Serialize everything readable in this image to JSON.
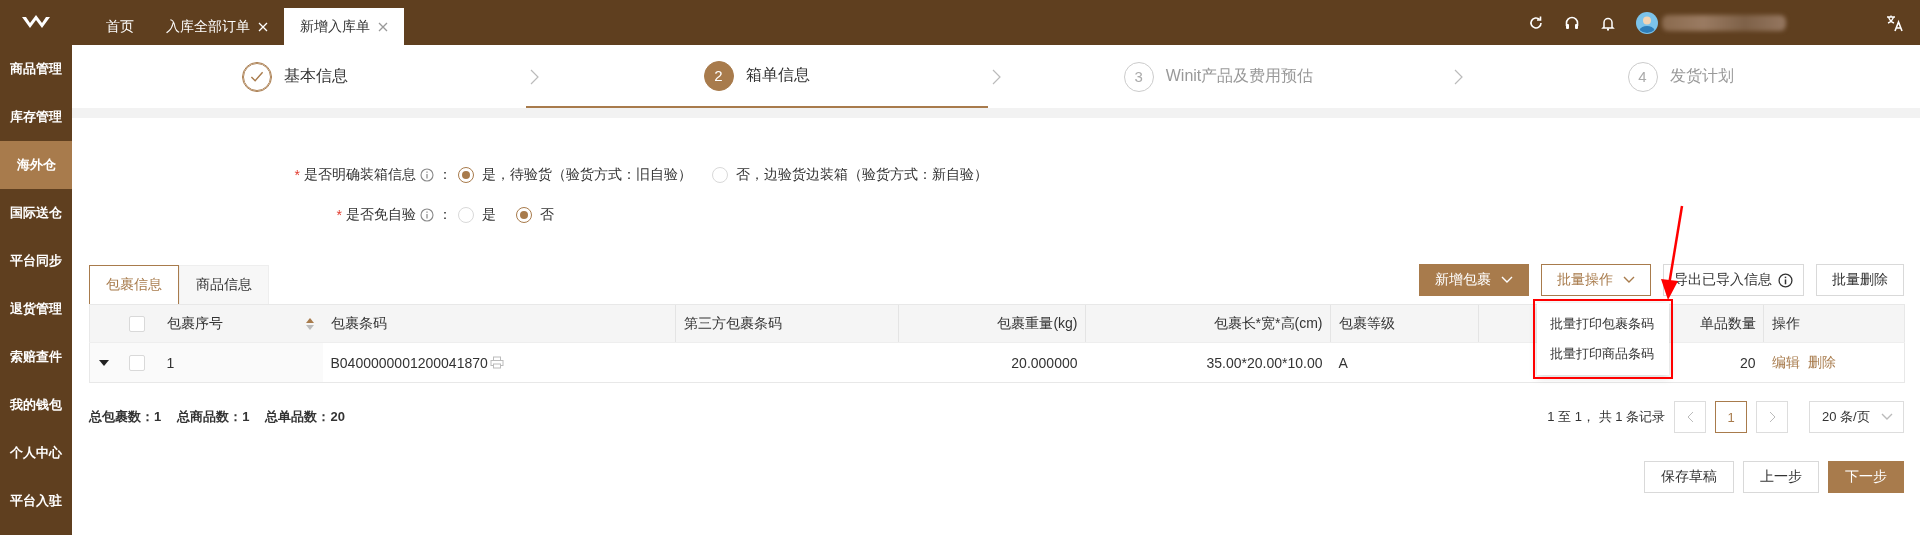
{
  "nav_tabs": [
    {
      "label": "首页",
      "closable": false,
      "selected": false
    },
    {
      "label": "入库全部订单",
      "closable": true,
      "selected": false
    },
    {
      "label": "新增入库单",
      "closable": true,
      "selected": true
    }
  ],
  "sidebar": {
    "items": [
      {
        "label": "商品管理",
        "selected": false
      },
      {
        "label": "库存管理",
        "selected": false
      },
      {
        "label": "海外仓",
        "selected": true
      },
      {
        "label": "国际送仓",
        "selected": false
      },
      {
        "label": "平台同步",
        "selected": false
      },
      {
        "label": "退货管理",
        "selected": false
      },
      {
        "label": "索赔查件",
        "selected": false
      },
      {
        "label": "我的钱包",
        "selected": false
      },
      {
        "label": "个人中心",
        "selected": false
      },
      {
        "label": "平台入驻",
        "selected": false
      }
    ]
  },
  "steps": [
    {
      "label": "基本信息",
      "done": true,
      "selected": false
    },
    {
      "number": "2",
      "label": "箱单信息",
      "done": false,
      "selected": true
    },
    {
      "number": "3",
      "label": "Winit产品及费用预估",
      "done": false,
      "selected": false
    },
    {
      "number": "4",
      "label": "发货计划",
      "done": false,
      "selected": false
    }
  ],
  "form": [
    {
      "required_mark": "*",
      "label": "是否明确装箱信息",
      "colon": "：",
      "options": [
        {
          "label": "是，待验货（验货方式：旧自验）",
          "selected": true
        },
        {
          "label": "否，边验货边装箱（验货方式：新自验）",
          "selected": false
        }
      ]
    },
    {
      "required_mark": "*",
      "label": "是否免自验",
      "colon": "：",
      "options": [
        {
          "label": "是",
          "selected": false
        },
        {
          "label": "否",
          "selected": true
        }
      ]
    }
  ],
  "content_tabs": [
    {
      "label": "包裹信息",
      "selected": true
    },
    {
      "label": "商品信息",
      "selected": false
    }
  ],
  "toolbar_buttons": [
    {
      "label": "新增包裹",
      "kind": "primary-dropdown",
      "expanded": false
    },
    {
      "label": "批量操作",
      "kind": "dropdown",
      "expanded": true
    },
    {
      "label": "导出已导入信息",
      "kind": "info",
      "expanded": false
    },
    {
      "label": "批量删除",
      "kind": "plain",
      "expanded": false
    }
  ],
  "dropdown_menu": [
    "批量打印包裹条码",
    "批量打印商品条码"
  ],
  "table": {
    "select_all_checked": false,
    "columns": [
      {
        "label": "包裹序号",
        "sortable": true
      },
      {
        "label": "包裹条码",
        "sortable": false
      },
      {
        "label": "第三方包裹条码",
        "sortable": false
      },
      {
        "label": "包裹重量(kg)",
        "sortable": false
      },
      {
        "label": "包裹长*宽*高(cm)",
        "sortable": false
      },
      {
        "label": "包裹等级",
        "sortable": false
      },
      {
        "sortable": false
      },
      {
        "label": "单品数量",
        "sortable": false
      },
      {
        "label": "操作",
        "sortable": false
      }
    ],
    "rows": [
      {
        "expanded": true,
        "checked": false,
        "cells": [
          "1",
          "B0400000001200041870",
          null,
          "20.000000",
          "35.00*20.00*10.00",
          "A",
          null,
          "20"
        ],
        "actions": [
          "编辑",
          "删除"
        ]
      }
    ]
  },
  "summary": [
    {
      "label": "总包裹数：",
      "value": "1"
    },
    {
      "label": "总商品数：",
      "value": "1"
    },
    {
      "label": "总单品数：",
      "value": "20"
    }
  ],
  "pagination": {
    "info": "1 至 1， 共 1 条记录",
    "pages": [
      {
        "label": "1",
        "selected": true
      }
    ],
    "page_size": "20 条/页"
  },
  "footer_buttons": [
    {
      "label": "保存草稿",
      "kind": "plain"
    },
    {
      "label": "上一步",
      "kind": "plain"
    },
    {
      "label": "下一步",
      "kind": "primary"
    }
  ]
}
